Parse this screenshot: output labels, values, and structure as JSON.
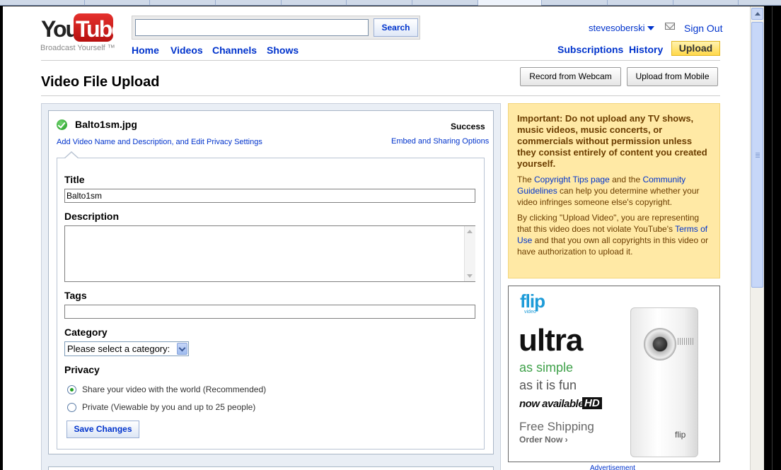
{
  "header": {
    "logo_you": "You",
    "logo_tube": "Tube",
    "tagline": "Broadcast Yourself ™",
    "search_button": "Search",
    "search_value": "",
    "nav": [
      "Home",
      "Videos",
      "Channels",
      "Shows"
    ],
    "username": "stevesoberski",
    "sign_out": "Sign Out",
    "subscriptions": "Subscriptions",
    "history": "History",
    "upload": "Upload"
  },
  "page": {
    "title": "Video File Upload",
    "record_webcam": "Record from Webcam",
    "upload_mobile": "Upload from Mobile"
  },
  "upload": {
    "filename": "Balto1sm.jpg",
    "status": "Success",
    "edit_link": "Add Video Name and Description, and Edit Privacy Settings",
    "embed_link": "Embed and Sharing Options",
    "form": {
      "title_label": "Title",
      "title_value": "Balto1sm",
      "description_label": "Description",
      "description_value": "",
      "tags_label": "Tags",
      "tags_value": "",
      "category_label": "Category",
      "category_selected": "Please select a category:",
      "privacy_label": "Privacy",
      "privacy_options": [
        {
          "label": "Share your video with the world (Recommended)",
          "selected": true
        },
        {
          "label": "Private (Viewable by you and up to 25 people)",
          "selected": false
        }
      ],
      "save_button": "Save Changes"
    }
  },
  "notice": {
    "important": "Important: Do not upload any TV shows, music videos, music concerts, or commercials without permission unless they consist entirely of content you created yourself.",
    "p1_before": "The ",
    "p1_link1": "Copyright Tips page",
    "p1_mid": " and the ",
    "p1_link2": "Community Guidelines",
    "p1_after": " can help you determine whether your video infringes someone else's copyright.",
    "p2_before": "By clicking \"Upload Video\", you are representing that this video does not violate YouTube's ",
    "p2_link": "Terms of Use",
    "p2_after": " and that you own all copyrights in this video or have authorization to upload it."
  },
  "ad": {
    "brand": "flip",
    "brand_sub": "video",
    "product": "ultra",
    "line1": "as simple",
    "line2": "as it is fun",
    "line3": "now available in",
    "hd": "HD",
    "shipping": "Free Shipping",
    "order": "Order Now ›",
    "camera_logo": "flip",
    "label": "Advertisement"
  },
  "colors": {
    "link": "#0033cc",
    "upload_button": "#ffd84a",
    "notice_bg": "#ffe9a5",
    "success": "#1e9a1e"
  }
}
